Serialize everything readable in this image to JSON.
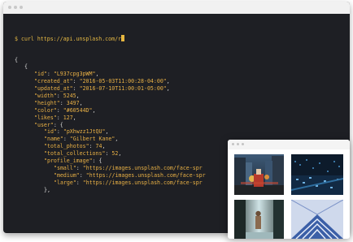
{
  "terminal": {
    "prompt": "$",
    "command": "curl https://api.unsplash.com/r",
    "lines": [
      {
        "indent": 0,
        "parts": [
          [
            "p",
            "{"
          ]
        ]
      },
      {
        "indent": 1,
        "parts": [
          [
            "p",
            "{"
          ]
        ]
      },
      {
        "indent": 2,
        "parts": [
          [
            "k",
            "\"id\""
          ],
          [
            "p",
            ": "
          ],
          [
            "s",
            "\"L937cpg3pWM\""
          ],
          [
            "p",
            ","
          ]
        ]
      },
      {
        "indent": 2,
        "parts": [
          [
            "k",
            "\"created_at\""
          ],
          [
            "p",
            ": "
          ],
          [
            "s",
            "\"2016-05-03T11:00:28-04:00\""
          ],
          [
            "p",
            ","
          ]
        ]
      },
      {
        "indent": 2,
        "parts": [
          [
            "k",
            "\"updated_at\""
          ],
          [
            "p",
            ": "
          ],
          [
            "s",
            "\"2016-07-10T11:00:01-05:00\""
          ],
          [
            "p",
            ","
          ]
        ]
      },
      {
        "indent": 2,
        "parts": [
          [
            "k",
            "\"width\""
          ],
          [
            "p",
            ": "
          ],
          [
            "n",
            "5245"
          ],
          [
            "p",
            ","
          ]
        ]
      },
      {
        "indent": 2,
        "parts": [
          [
            "k",
            "\"height\""
          ],
          [
            "p",
            ": "
          ],
          [
            "n",
            "3497"
          ],
          [
            "p",
            ","
          ]
        ]
      },
      {
        "indent": 2,
        "parts": [
          [
            "k",
            "\"color\""
          ],
          [
            "p",
            ": "
          ],
          [
            "s",
            "\"#60544D\""
          ],
          [
            "p",
            ","
          ]
        ]
      },
      {
        "indent": 2,
        "parts": [
          [
            "k",
            "\"likes\""
          ],
          [
            "p",
            ": "
          ],
          [
            "n",
            "127"
          ],
          [
            "p",
            ","
          ]
        ]
      },
      {
        "indent": 2,
        "parts": [
          [
            "k",
            "\"user\""
          ],
          [
            "p",
            ": {"
          ]
        ]
      },
      {
        "indent": 3,
        "parts": [
          [
            "k",
            "\"id\""
          ],
          [
            "p",
            ": "
          ],
          [
            "s",
            "\"pXhwzz1JtQU\""
          ],
          [
            "p",
            ","
          ]
        ]
      },
      {
        "indent": 3,
        "parts": [
          [
            "k",
            "\"name\""
          ],
          [
            "p",
            ": "
          ],
          [
            "s",
            "\"Gilbert Kane\""
          ],
          [
            "p",
            ","
          ]
        ]
      },
      {
        "indent": 3,
        "parts": [
          [
            "k",
            "\"total_photos\""
          ],
          [
            "p",
            ": "
          ],
          [
            "n",
            "74"
          ],
          [
            "p",
            ","
          ]
        ]
      },
      {
        "indent": 3,
        "parts": [
          [
            "k",
            "\"total_collections\""
          ],
          [
            "p",
            ": "
          ],
          [
            "n",
            "52"
          ],
          [
            "p",
            ","
          ]
        ]
      },
      {
        "indent": 3,
        "parts": [
          [
            "k",
            "\"profile_image\""
          ],
          [
            "p",
            ": {"
          ]
        ]
      },
      {
        "indent": 4,
        "parts": [
          [
            "k",
            "\"small\""
          ],
          [
            "p",
            ": "
          ],
          [
            "s",
            "\"https://images.unsplash.com/face-spr"
          ]
        ]
      },
      {
        "indent": 4,
        "parts": [
          [
            "k",
            "\"medium\""
          ],
          [
            "p",
            ": "
          ],
          [
            "s",
            "\"https://images.unsplash.com/face-spr"
          ]
        ]
      },
      {
        "indent": 4,
        "parts": [
          [
            "k",
            "\"large\""
          ],
          [
            "p",
            ": "
          ],
          [
            "s",
            "\"https://images.unsplash.com/face-spr"
          ]
        ]
      },
      {
        "indent": 3,
        "parts": [
          [
            "p",
            "},"
          ]
        ]
      }
    ]
  },
  "photos": [
    {
      "name": "city-street-photo"
    },
    {
      "name": "night-city-aerial-photo"
    },
    {
      "name": "waterfall-person-photo"
    },
    {
      "name": "architecture-lines-photo"
    }
  ],
  "colors": {
    "terminal_bg": "#1e1f24",
    "accent": "#e8b045"
  }
}
